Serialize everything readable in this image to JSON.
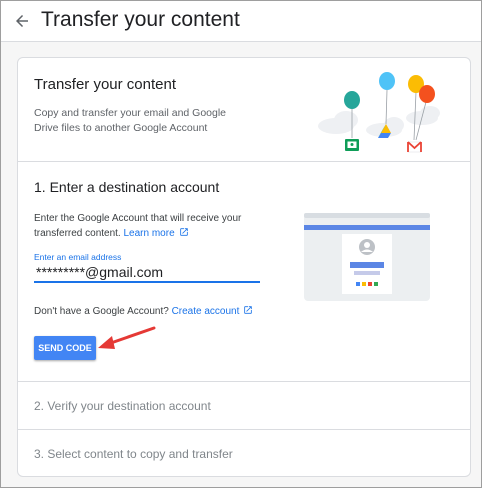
{
  "header": {
    "title": "Transfer your content",
    "back_icon": "arrow-back-icon"
  },
  "intro": {
    "title": "Transfer your content",
    "description": "Copy and transfer your email and Google Drive files to another Google Account"
  },
  "step1": {
    "title": "1. Enter a destination account",
    "description": "Enter the Google Account that will receive your transferred content.",
    "learn_more": "Learn more",
    "email_label": "Enter an email address",
    "email_value": "*********@gmail.com",
    "no_account_text": "Don't have a Google Account?",
    "create_account": "Create account",
    "send_code": "SEND CODE"
  },
  "step2": {
    "title": "2. Verify your destination account"
  },
  "step3": {
    "title": "3. Select content to copy and transfer"
  },
  "colors": {
    "accent": "#1a73e8",
    "button": "#4285f4",
    "annotation_arrow": "#e53935"
  }
}
